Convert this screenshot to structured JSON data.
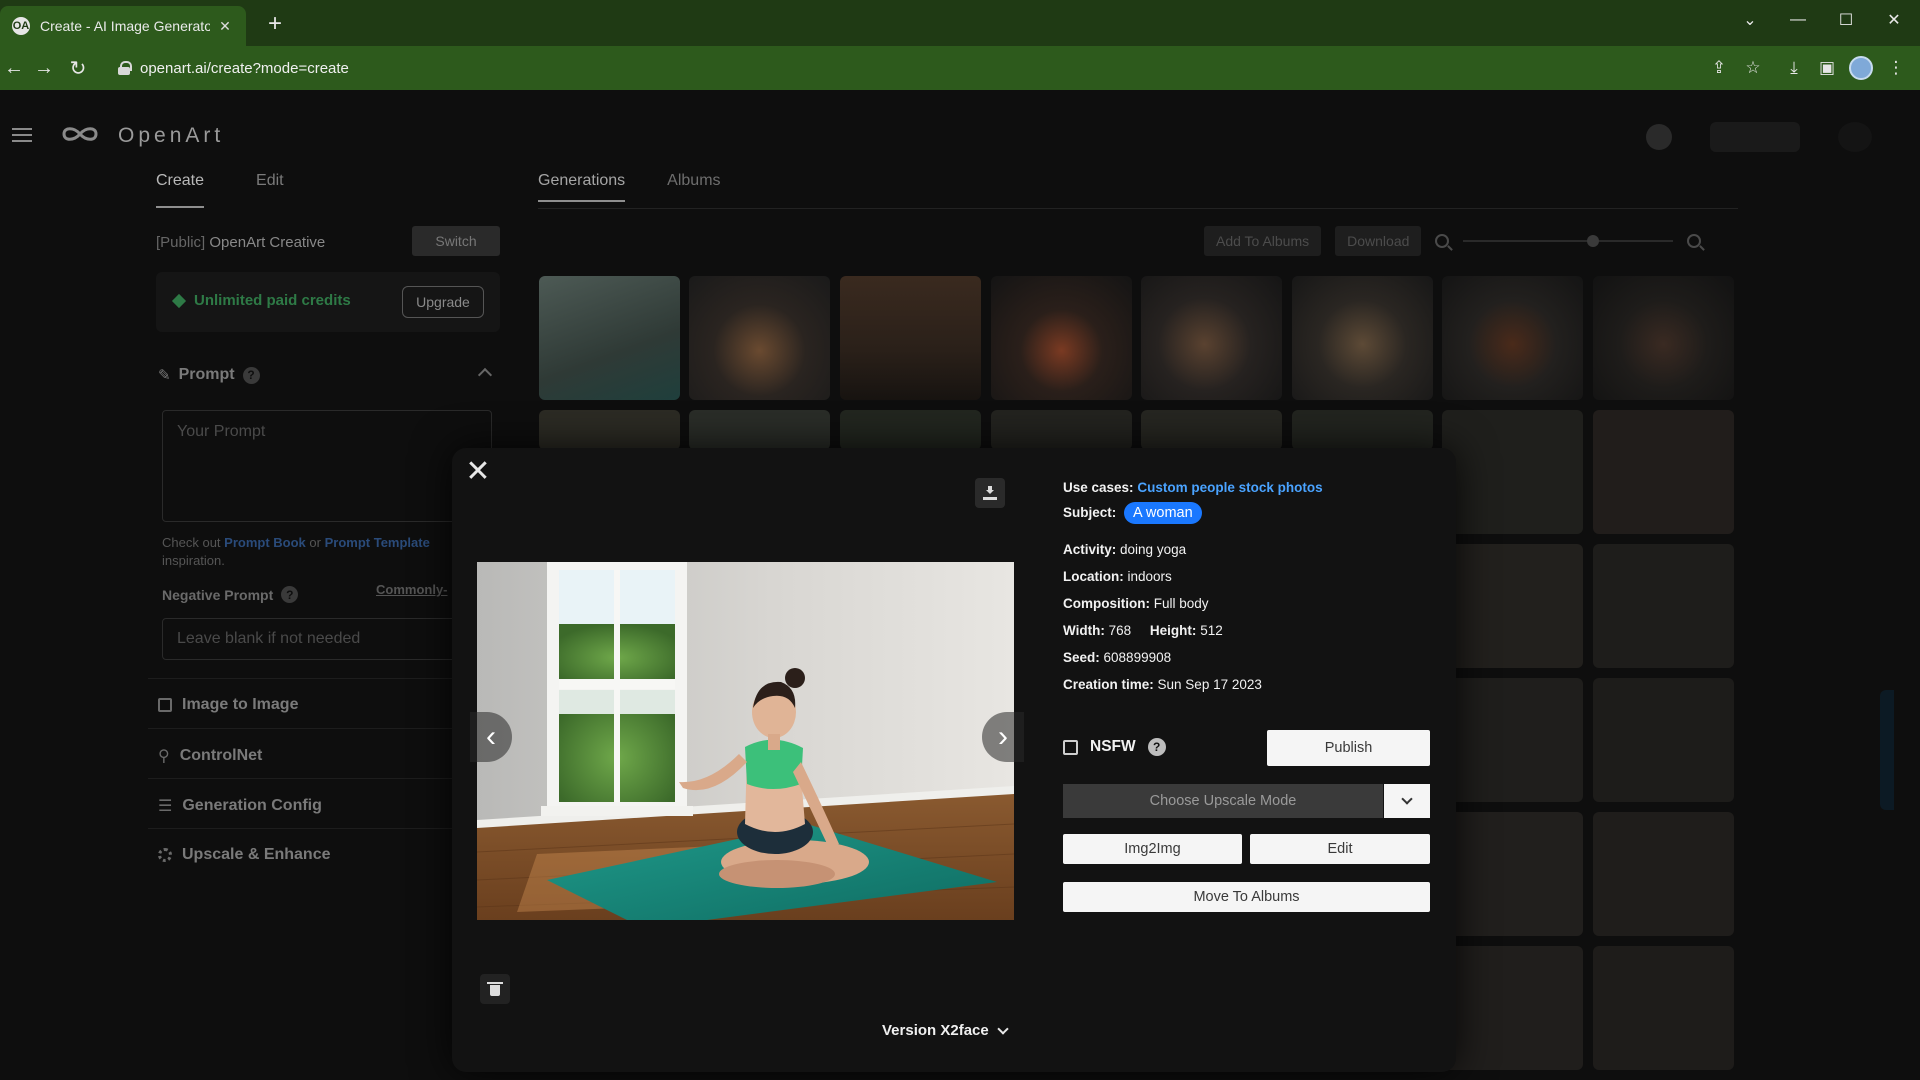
{
  "browser": {
    "tab_title": "Create - AI Image Generator | Op",
    "tab_favicon": "OA",
    "url": "openart.ai/create?mode=create"
  },
  "app": {
    "brand": "OpenArt",
    "left_tabs": [
      "Create",
      "Edit"
    ],
    "gen_tabs": [
      "Generations",
      "Albums"
    ],
    "workspace_prefix": "[Public]",
    "workspace_name": "OpenArt Creative",
    "switch_label": "Switch",
    "credits_label": "Unlimited paid credits",
    "upgrade_label": "Upgrade",
    "prompt_label": "Prompt",
    "prompt_placeholder": "Your Prompt",
    "prompt_hint_pre": "Check out",
    "prompt_hint_link1": "Prompt Book",
    "prompt_hint_mid": "or",
    "prompt_hint_link2": "Prompt Template",
    "prompt_hint_post": "inspiration.",
    "negative_label": "Negative Prompt",
    "negative_link": "Commonly-",
    "negative_placeholder": "Leave blank if not needed",
    "sections": [
      "Image to Image",
      "ControlNet",
      "Generation Config",
      "Upscale & Enhance"
    ],
    "add_to_albums": "Add To Albums",
    "download": "Download"
  },
  "modal": {
    "use_cases_key": "Use cases:",
    "use_cases_value": "Custom people stock photos",
    "subject_key": "Subject:",
    "subject_value": "A woman",
    "activity_key": "Activity:",
    "activity_value": "doing yoga",
    "location_key": "Location:",
    "location_value": "indoors",
    "composition_key": "Composition:",
    "composition_value": "Full body",
    "width_key": "Width:",
    "width_value": "768",
    "height_key": "Height:",
    "height_value": "512",
    "seed_key": "Seed:",
    "seed_value": "608899908",
    "creation_key": "Creation time:",
    "creation_value": "Sun Sep 17 2023",
    "nsfw_label": "NSFW",
    "publish_label": "Publish",
    "upscale_label": "Choose Upscale Mode",
    "img2img_label": "Img2Img",
    "edit_label": "Edit",
    "move_albums_label": "Move To Albums",
    "version_label": "Version X2face"
  },
  "icons": {
    "close": "close-icon",
    "download": "download-icon",
    "trash": "trash-icon",
    "prev": "chevron-left-icon",
    "next": "chevron-right-icon"
  },
  "colors": {
    "browser_green": "#2d5a1c",
    "accent_blue": "#1a78ff",
    "link_blue": "#4aa3ff",
    "credit_green": "#2e7a46"
  }
}
